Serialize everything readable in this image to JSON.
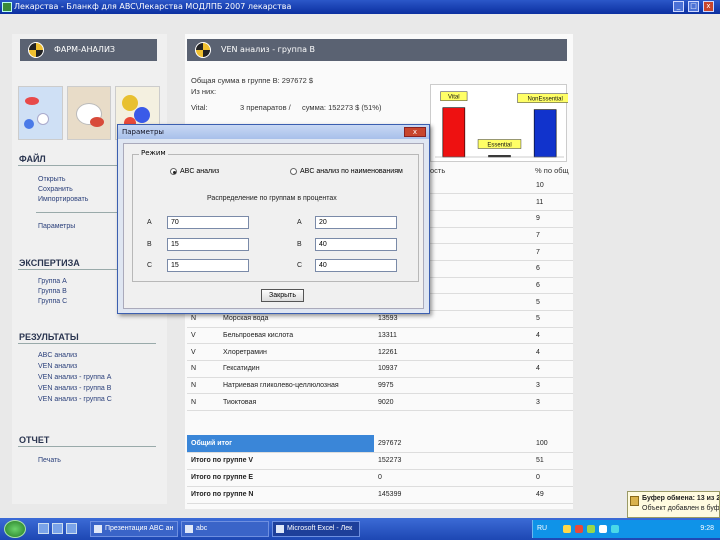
{
  "window": {
    "title": "Лекарства - Бланкф для ABC\\Лекарства МОДЛПБ 2007 лекарства",
    "minimize": "_",
    "maximize": "□",
    "close": "x"
  },
  "left_panel": {
    "header": "ФАРМ-АНАЛИЗ",
    "sections": [
      {
        "title": "ФАЙЛ",
        "items": [
          "Открыть",
          "Сохранить",
          "Импортировать"
        ],
        "extra": "Параметры"
      },
      {
        "title": "ЭКСПЕРТИЗА",
        "items": [
          "Группа А",
          "Группа В",
          "Группа С"
        ]
      },
      {
        "title": "РЕЗУЛЬТАТЫ",
        "items": [
          "ABC анализ",
          "VEN анализ",
          "VEN анализ - группа А",
          "VEN анализ - группа В",
          "VEN анализ - группа С"
        ]
      },
      {
        "title": "ОТЧЕТ",
        "items": [
          "Печать"
        ]
      }
    ]
  },
  "main": {
    "header": "VEN анализ - группа В",
    "info": {
      "line1": "Общая сумма в группе В:   297672 $",
      "line2": "Из них:",
      "line3a": "Vital:",
      "line3b": "3 препаратов /",
      "line3c": "сумма:  152273 $ (51%)"
    },
    "table": {
      "header_visible": "ость",
      "header_pct": "% по общ",
      "rows": [
        {
          "cat": "",
          "name": "",
          "sum": "",
          "pct": "10"
        },
        {
          "cat": "",
          "name": "",
          "sum": "",
          "pct": "11"
        },
        {
          "cat": "",
          "name": "",
          "sum": "",
          "pct": "9"
        },
        {
          "cat": "",
          "name": "",
          "sum": "",
          "pct": "7"
        },
        {
          "cat": "",
          "name": "",
          "sum": "",
          "pct": "7"
        },
        {
          "cat": "",
          "name": "",
          "sum": "",
          "pct": "6"
        },
        {
          "cat": "",
          "name": "",
          "sum": "",
          "pct": "6"
        },
        {
          "cat": "N",
          "name": "Трамель С",
          "sum": "16083",
          "pct": "5"
        },
        {
          "cat": "N",
          "name": "Морская вода",
          "sum": "13593",
          "pct": "5"
        },
        {
          "cat": "V",
          "name": "Бельпроевая кислота",
          "sum": "13311",
          "pct": "4"
        },
        {
          "cat": "V",
          "name": "Хлоретрамин",
          "sum": "12261",
          "pct": "4"
        },
        {
          "cat": "N",
          "name": "Гексатидин",
          "sum": "10937",
          "pct": "4"
        },
        {
          "cat": "N",
          "name": "Натриевая гликолево-целлюлозная",
          "sum": "9975",
          "pct": "3"
        },
        {
          "cat": "N",
          "name": "Тиоктовая",
          "sum": "9020",
          "pct": "3"
        }
      ]
    },
    "totals": [
      {
        "label": "Общий итог",
        "sum": "297672",
        "pct": "100"
      },
      {
        "label": "Итого по группе V",
        "sum": "152273",
        "pct": "51"
      },
      {
        "label": "Итого по группе E",
        "sum": "0",
        "pct": "0"
      },
      {
        "label": "Итого по группе N",
        "sum": "145399",
        "pct": "49"
      }
    ]
  },
  "chart_data": {
    "type": "bar",
    "categories": [
      "Vital",
      "Essential",
      "NonEssential"
    ],
    "values": [
      51,
      0,
      49
    ],
    "colors": [
      "#ee1111",
      "#222222",
      "#1133cc"
    ],
    "ylim": [
      0,
      60
    ],
    "legend": "labels above bars",
    "grid": false
  },
  "dialog": {
    "title": "Параметры",
    "close": "x",
    "group_label": "Режим",
    "radio1": "ABC анализ",
    "radio2": "ABC анализ по наименованиям",
    "distribution_label": "Распределение по группам в процентах",
    "left": [
      {
        "label": "A",
        "value": "70"
      },
      {
        "label": "B",
        "value": "15"
      },
      {
        "label": "C",
        "value": "15"
      }
    ],
    "right": [
      {
        "label": "A",
        "value": "20"
      },
      {
        "label": "B",
        "value": "40"
      },
      {
        "label": "C",
        "value": "40"
      }
    ],
    "close_button": "Закрыть"
  },
  "clipboard_tip": {
    "line1": "Буфер обмена: 13 из 24",
    "line2": "Объект добавлен в буфер"
  },
  "taskbar": {
    "tasks": [
      "Презентация ABC ан",
      "abc",
      "Microsoft Excel - Лек"
    ],
    "lang": "RU",
    "time": "9:28"
  }
}
